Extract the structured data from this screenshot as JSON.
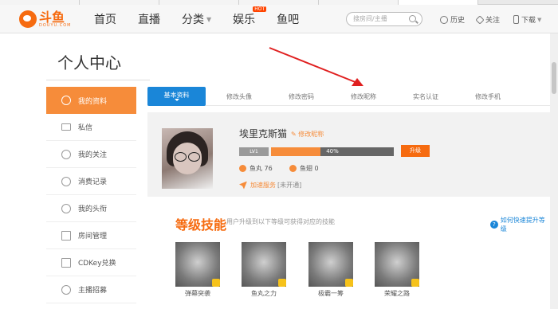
{
  "logo": {
    "cn": "斗鱼",
    "en": "DOUYU.COM"
  },
  "nav": {
    "items": [
      "首页",
      "直播",
      "分类",
      "娱乐",
      "鱼吧"
    ],
    "hot_badge": "HOT"
  },
  "search": {
    "placeholder": "搜房间/主播"
  },
  "tools": {
    "history": "历史",
    "follow": "关注",
    "download": "下载"
  },
  "page_title": "个人中心",
  "sidebar": {
    "items": [
      {
        "label": "我的资料",
        "active": true,
        "icon": "user-icon"
      },
      {
        "label": "私信",
        "icon": "mail-icon"
      },
      {
        "label": "我的关注",
        "icon": "heart-icon"
      },
      {
        "label": "消费记录",
        "icon": "receipt-icon"
      },
      {
        "label": "我的头衔",
        "icon": "badge-icon"
      },
      {
        "label": "房间管理",
        "icon": "house-icon"
      },
      {
        "label": "CDKey兑换",
        "icon": "key-icon"
      },
      {
        "label": "主播招募",
        "icon": "people-icon"
      }
    ]
  },
  "tabs": [
    "基本资料",
    "修改头像",
    "修改密码",
    "修改昵称",
    "实名认证",
    "修改手机"
  ],
  "profile": {
    "username": "埃里克斯猫",
    "edit_label": "修改昵称",
    "level": "LV1",
    "progress_text": "40%",
    "progress_value": 0.4,
    "upgrade_label": "升级",
    "fish_balls": "鱼丸 76",
    "fish_fins": "鱼翅 0",
    "speed_service": "加速服务",
    "speed_status": "[未开通]"
  },
  "skills": {
    "title": "等级技能",
    "subtitle": "用户升级到以下等级可获得对应的技能",
    "help_label": "如何快速提升等级",
    "items": [
      "弹幕突袭",
      "鱼丸之力",
      "极霸一筹",
      "荣耀之路"
    ]
  },
  "colors": {
    "accent": "#f68c3a",
    "brand": "#f66b10",
    "blue": "#1a86d8",
    "annotation": "#e02020"
  }
}
